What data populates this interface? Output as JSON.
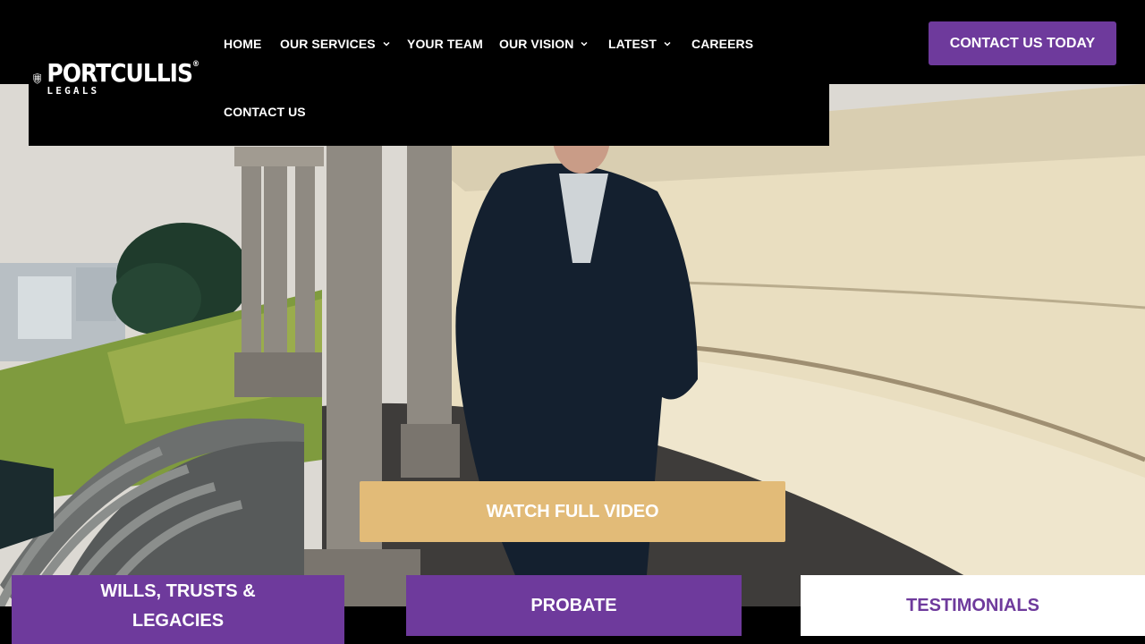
{
  "brand": {
    "name": "PORTCULLIS",
    "registered_mark": "®",
    "tagline": "LEGALS",
    "icon": "portcullis-shield-icon"
  },
  "nav": {
    "items": [
      {
        "label": "HOME",
        "has_dropdown": false
      },
      {
        "label": "OUR SERVICES",
        "has_dropdown": true
      },
      {
        "label": "YOUR TEAM",
        "has_dropdown": false
      },
      {
        "label": "OUR VISION",
        "has_dropdown": true
      },
      {
        "label": "LATEST",
        "has_dropdown": true
      },
      {
        "label": "CAREERS",
        "has_dropdown": false
      },
      {
        "label": "CONTACT US",
        "has_dropdown": false
      }
    ],
    "dropdown_icon": "chevron-down-icon"
  },
  "header": {
    "cta_label": "CONTACT US TODAY"
  },
  "hero": {
    "watch_label": "WATCH FULL VIDEO"
  },
  "tabs": {
    "wills_line1": "WILLS, TRUSTS &",
    "wills_line2": "LEGACIES",
    "probate": "PROBATE",
    "testimonials": "TESTIMONIALS",
    "active": "TESTIMONIALS"
  },
  "colors": {
    "purple": "#6e3a9c",
    "gold": "#e2bb78",
    "header_bg": "#000000",
    "text_light": "#ffffff"
  }
}
